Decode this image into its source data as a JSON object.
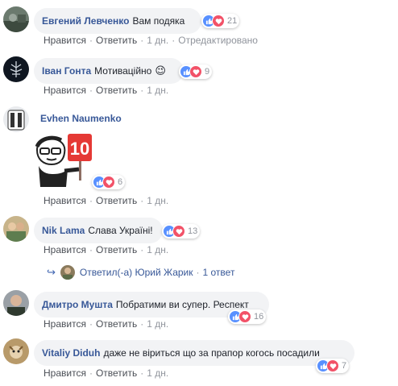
{
  "action_labels": {
    "like": "Нравится",
    "reply": "Ответить",
    "sep": "·"
  },
  "comments": [
    {
      "author": "Евгений Левченко",
      "text": "Вам подяка",
      "reactions": "21",
      "time": "1 дн.",
      "edited": "Отредактировано"
    },
    {
      "author": "Іван Гонта",
      "text": "Мотиваційно",
      "emoji": "😉",
      "reactions": "9",
      "time": "1 дн."
    },
    {
      "author": "Evhen Naumenko",
      "sticker_number": "10",
      "reactions": "6",
      "time": "1 дн."
    },
    {
      "author": "Nik Lama",
      "text": "Слава Україні!",
      "reactions": "13",
      "time": "1 дн."
    },
    {
      "author": "Дмитро Мушта",
      "text": "Побратими ви супер. Респект",
      "reactions": "16",
      "time": "1 дн."
    },
    {
      "author": "Vitaliy Diduh",
      "text": "даже не віриться що за прапор когось посадили",
      "reactions": "7",
      "time": "1 дн."
    }
  ],
  "reply_thread": {
    "label": "Ответил(-а) Юрий Жарик",
    "count": "1 ответ"
  },
  "colors": {
    "link": "#385898",
    "bubble": "#f2f3f5",
    "like": "#5890ff",
    "love": "#f25268",
    "muted": "#90949c"
  },
  "icons": {
    "like": "thumbs-up-icon",
    "love": "heart-icon",
    "reply_arrow": "reply-arrow-icon"
  }
}
